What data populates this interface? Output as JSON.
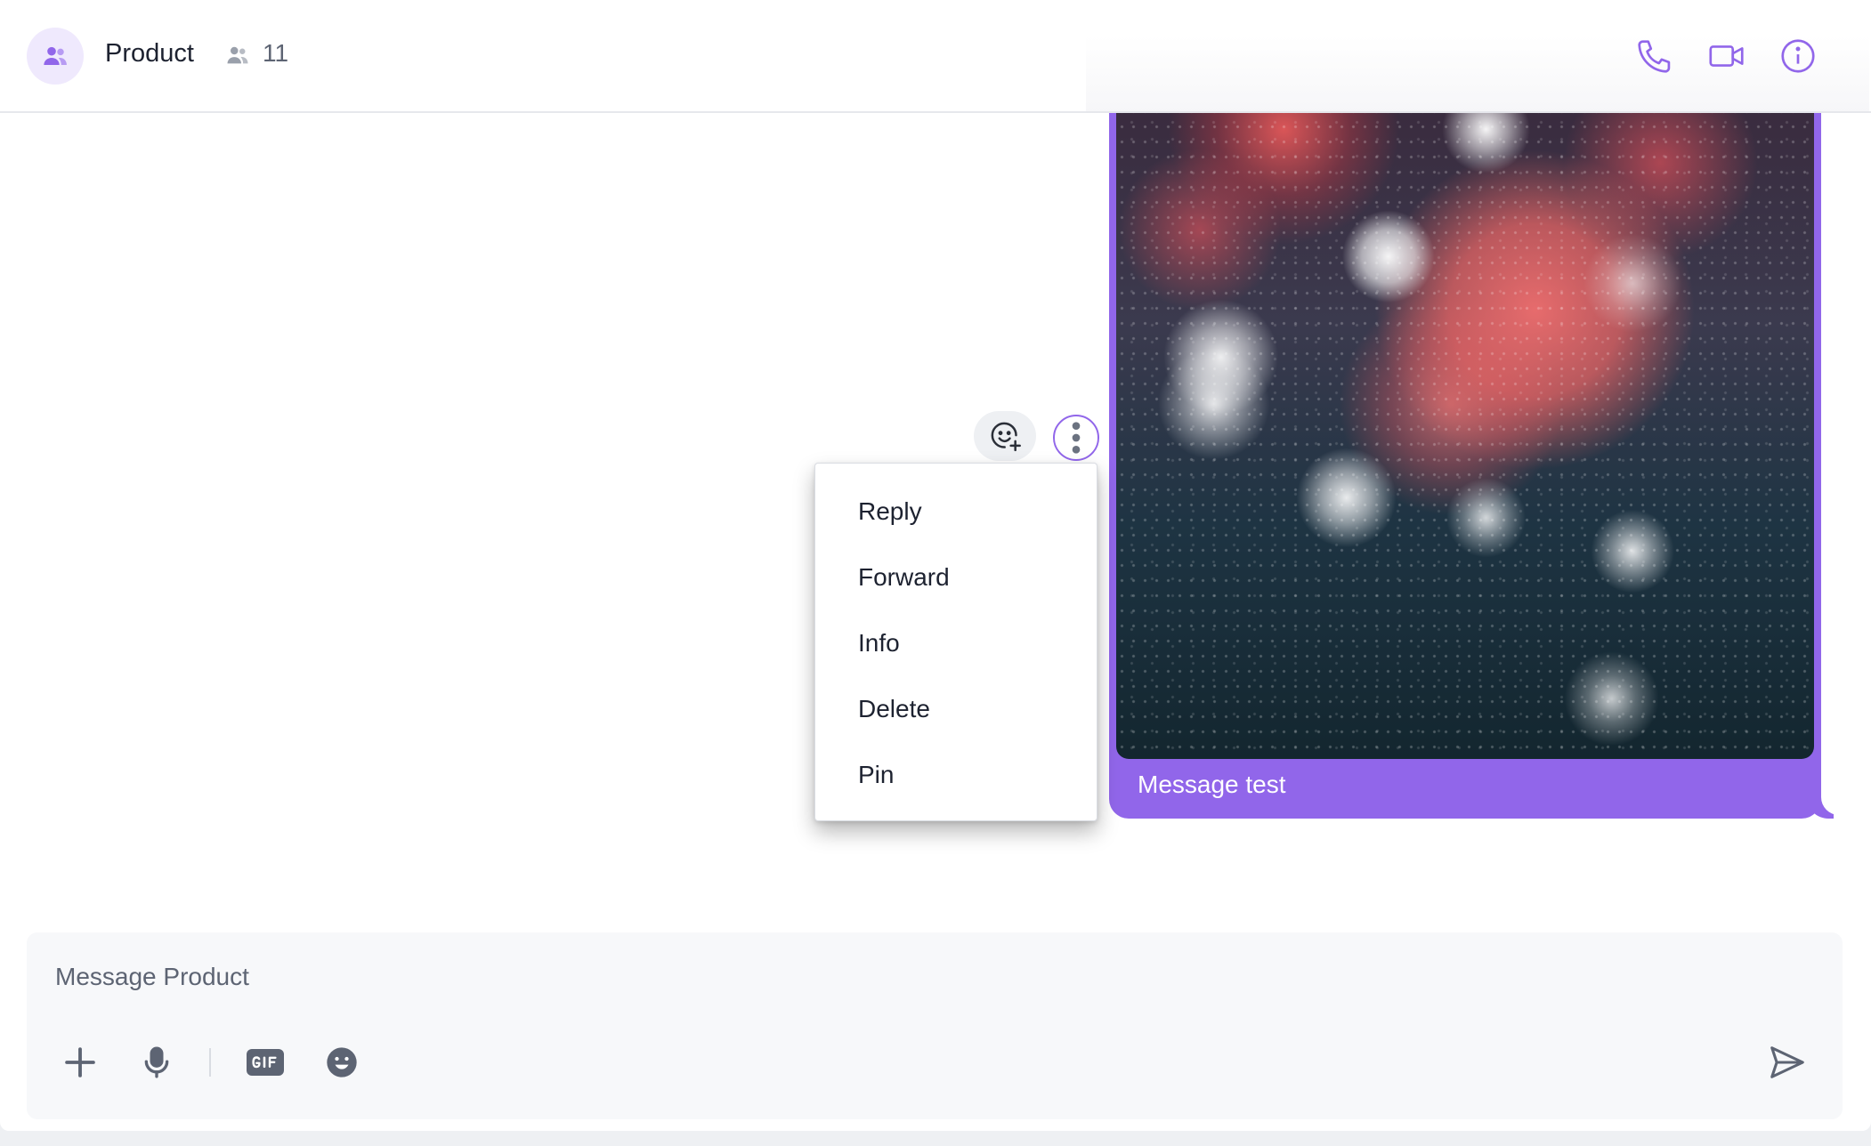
{
  "header": {
    "title": "Product",
    "member_count": "11",
    "group_avatar_icon": "group-icon",
    "member_icon": "members-icon",
    "actions": [
      {
        "name": "call",
        "icon": "phone-icon"
      },
      {
        "name": "video",
        "icon": "video-icon"
      },
      {
        "name": "info",
        "icon": "info-icon"
      }
    ]
  },
  "message": {
    "text": "Message test",
    "bubble_color": "#9166ea",
    "has_image": true
  },
  "message_actions": {
    "react_icon": "add-reaction-icon",
    "more_icon": "more-vertical-icon"
  },
  "context_menu": {
    "items": [
      {
        "label": "Reply"
      },
      {
        "label": "Forward"
      },
      {
        "label": "Info"
      },
      {
        "label": "Delete"
      },
      {
        "label": "Pin"
      }
    ]
  },
  "composer": {
    "placeholder": "Message Product",
    "value": "",
    "tools": [
      "plus-icon",
      "microphone-icon",
      "gif-icon",
      "emoji-icon"
    ],
    "send_icon": "send-icon"
  },
  "colors": {
    "accent": "#9166ea",
    "icon": "#5d6473"
  }
}
